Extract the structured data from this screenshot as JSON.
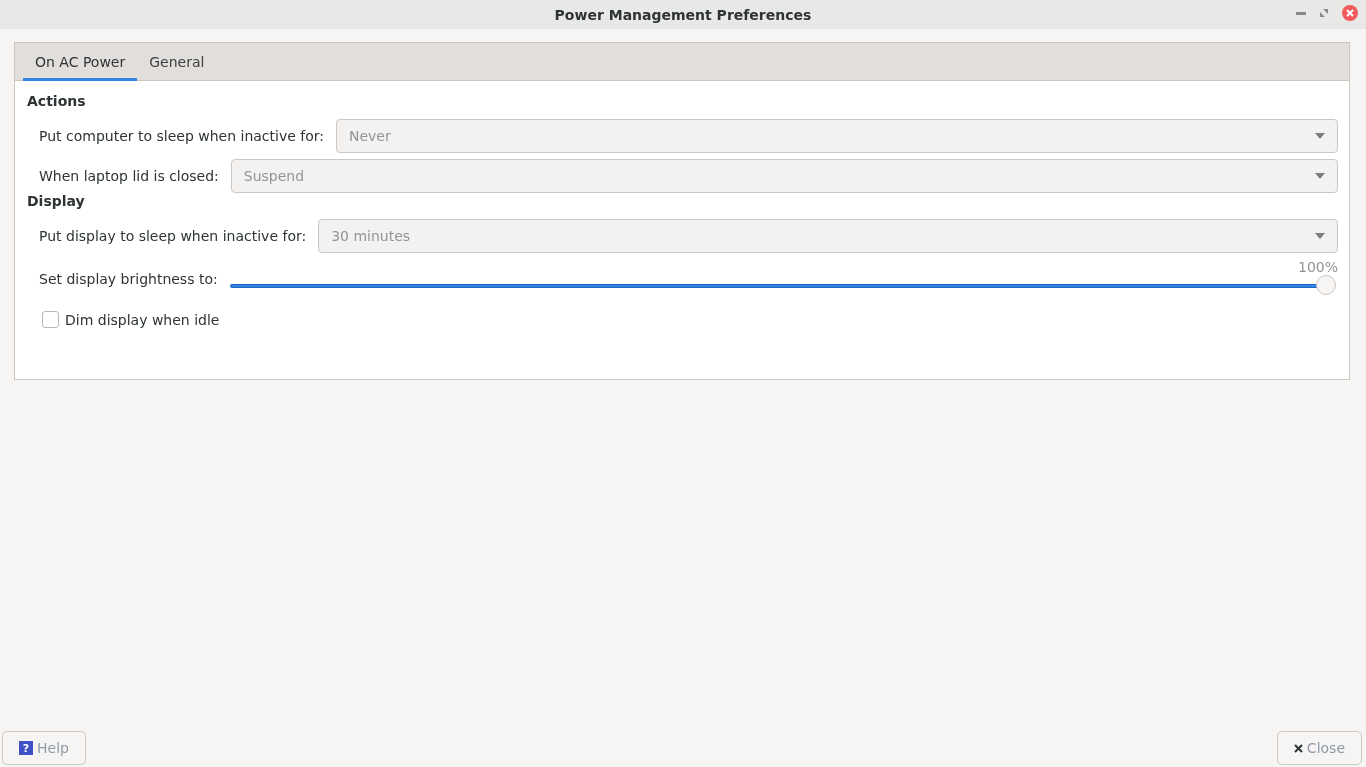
{
  "window": {
    "title": "Power Management Preferences"
  },
  "tabs": [
    {
      "label": "On AC Power",
      "selected": true
    },
    {
      "label": "General",
      "selected": false
    }
  ],
  "sections": [
    {
      "title": "Actions",
      "rows": [
        {
          "kind": "dropdown",
          "label": "Put computer to sleep when inactive for:",
          "value": "Never",
          "disabled": true
        },
        {
          "kind": "dropdown",
          "label": "When laptop lid is closed:",
          "value": "Suspend",
          "disabled": true
        }
      ]
    },
    {
      "title": "Display",
      "rows": [
        {
          "kind": "dropdown",
          "label": "Put display to sleep when inactive for:",
          "value": "30 minutes",
          "disabled": true
        },
        {
          "kind": "slider",
          "label": "Set display brightness to:",
          "reading": "100%",
          "level": 1
        },
        {
          "kind": "checkbox",
          "label": "Dim display when idle",
          "checked": false
        }
      ]
    }
  ],
  "buttons": {
    "help": {
      "icon": "?",
      "label": "Help"
    },
    "close": {
      "label": "Close"
    }
  }
}
